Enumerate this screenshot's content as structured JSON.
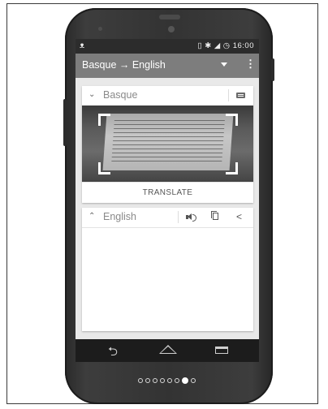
{
  "status_bar": {
    "left_icon": "cat-icon",
    "right_icons": "🔒 ✱ ▾ ◢ ◷",
    "time": "16:00"
  },
  "app_bar": {
    "title": "Basque → English"
  },
  "source_card": {
    "language": "Basque",
    "translate_button": "TRANSLATE"
  },
  "target_card": {
    "language": "English"
  },
  "pager": {
    "count": 8,
    "active_index": 6
  },
  "colors": {
    "app_bar": "#7d7d7d",
    "status_bar": "#2c2c2c",
    "screen_bg": "#e9e9e9",
    "phone_body": "#333333"
  }
}
